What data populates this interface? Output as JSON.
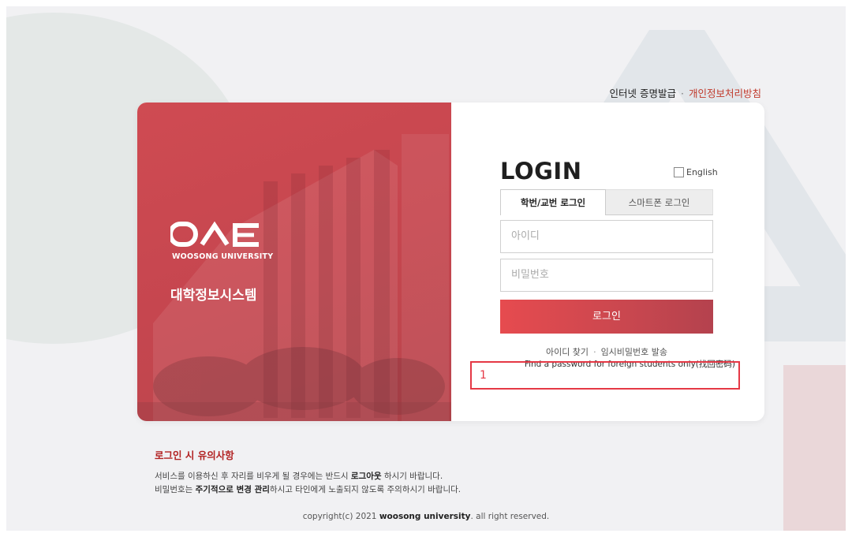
{
  "top_links": {
    "certificate": "인터넷 증명발급",
    "separator": "·",
    "privacy": "개인정보처리방침"
  },
  "brand": {
    "logo_text": "WOOSONG UNIVERSITY",
    "system_title": "대학정보시스템"
  },
  "login": {
    "title": "LOGIN",
    "english_label": "English",
    "tabs": [
      {
        "label": "학번/교번 로그인",
        "active": true
      },
      {
        "label": "스마트폰 로그인",
        "active": false
      }
    ],
    "id_placeholder": "아이디",
    "pw_placeholder": "비밀번호",
    "button_label": "로그인",
    "find_id": "아이디 찾기",
    "link_separator": "·",
    "temp_password": "임시비밀번호 발송",
    "foreign_link": "Find a password for foreign students only(找回密码)"
  },
  "annotation": {
    "number": "1",
    "color": "#e53845"
  },
  "notice": {
    "title": "로그인 시 유의사항",
    "line1_pre": "서비스를 이용하신 후 자리를 비우게 될 경우에는 반드시 ",
    "line1_bold": "로그아웃",
    "line1_post": " 하시기 바랍니다.",
    "line2_pre": "비밀번호는 ",
    "line2_bold": "주기적으로 변경 관리",
    "line2_post": "하시고 타인에게 노출되지 않도록 주의하시기 바랍니다."
  },
  "footer": {
    "pre": "copyright(c) 2021 ",
    "bold": "woosong university",
    "post": ". all right reserved."
  },
  "colors": {
    "accent": "#c9474f",
    "privacy_link": "#c0392b",
    "notice_title": "#b22222"
  }
}
